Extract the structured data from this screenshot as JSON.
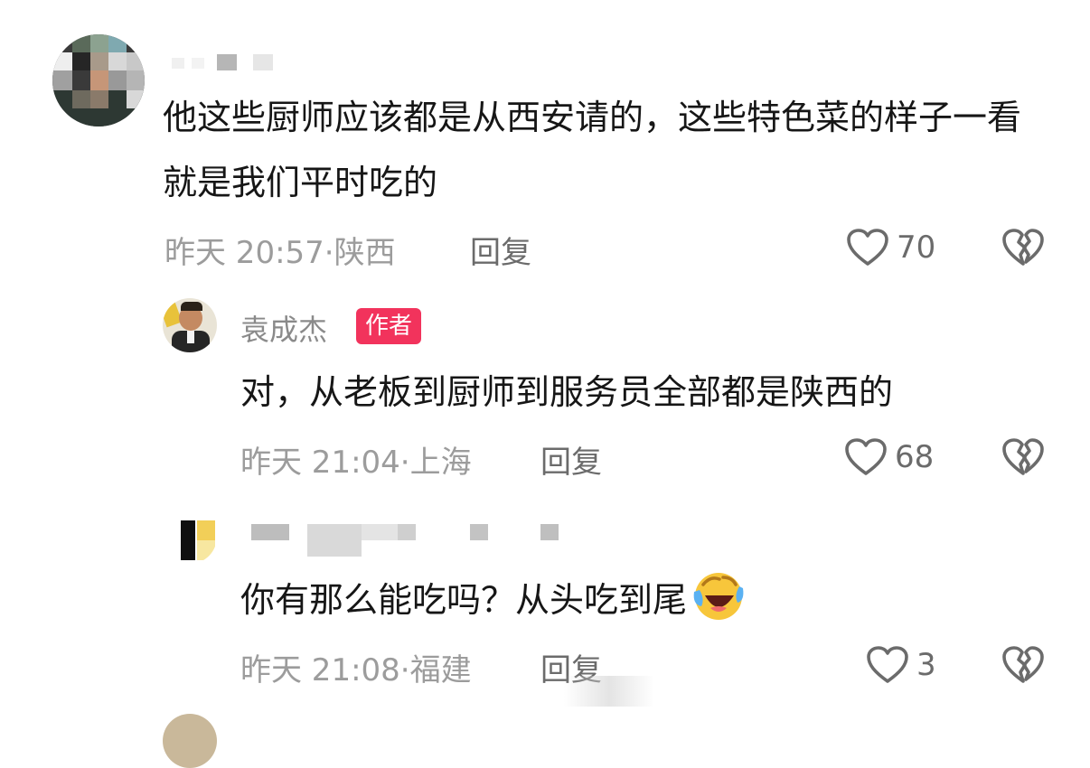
{
  "comments": [
    {
      "content": "他这些厨师应该都是从西安请的，这些特色菜的样子一看就是我们平时吃的",
      "time": "昨天 20:57",
      "location": "陕西",
      "reply_label": "回复",
      "likes": "70"
    },
    {
      "username": "袁成杰",
      "badge": "作者",
      "content": "对，从老板到厨师到服务员全部都是陕西的",
      "time": "昨天 21:04",
      "location": "上海",
      "reply_label": "回复",
      "likes": "68"
    },
    {
      "content": "你有那么能吃吗？从头吃到尾",
      "emoji": "laughing-crying-face",
      "time": "昨天 21:08",
      "location": "福建",
      "reply_label": "回复",
      "likes": "3"
    }
  ],
  "separator": "·",
  "colors": {
    "badge": "#f2335c",
    "meta": "#9c9c9c",
    "content": "#161616",
    "icon": "#6b6b6b"
  }
}
